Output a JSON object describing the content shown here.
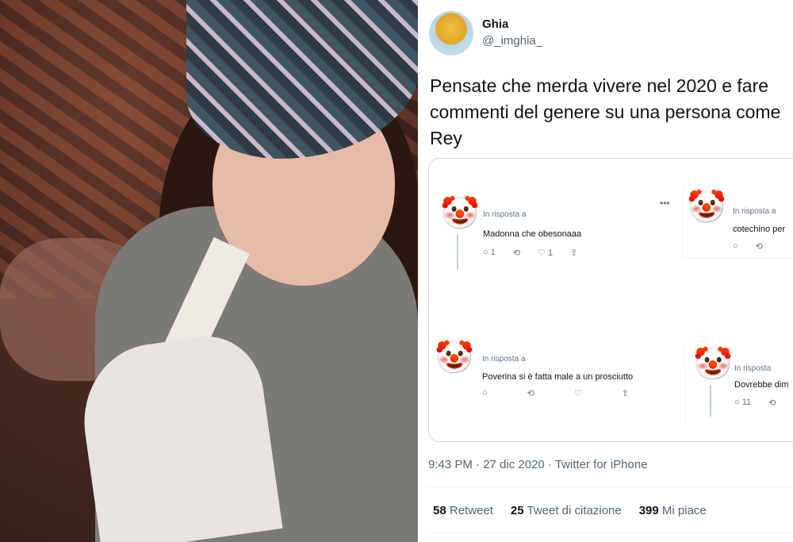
{
  "tweet": {
    "author_name": "Ghia",
    "author_handle": "@_imghia_",
    "text_lines": [
      "Pensate che merda vivere nel 2020 e fare",
      "commenti del genere su una persona come",
      "Rey"
    ],
    "timestamp": "9:43 PM · 27 dic 2020 · Twitter for iPhone",
    "stats": {
      "retweets": {
        "count": "58",
        "label": "Retweet"
      },
      "quotes": {
        "count": "25",
        "label": "Tweet di citazione"
      },
      "likes": {
        "count": "399",
        "label": "Mi piace"
      }
    }
  },
  "embedded_replies": [
    {
      "emoji": "🤡",
      "reply_label": "In risposta a",
      "text": "Madonna che obesonaaa",
      "actions": [
        "1",
        "",
        "1",
        ""
      ]
    },
    {
      "emoji": "🤡",
      "reply_label": "In risposta a",
      "text": "cotechino per",
      "actions": [
        "",
        ""
      ]
    },
    {
      "emoji": "🤡",
      "reply_label": "In risposta a",
      "text": "Poverina si è fatta male a un prosciutto",
      "actions": [
        "",
        "",
        "",
        ""
      ]
    },
    {
      "emoji": "🤡",
      "reply_label": "In risposta",
      "text": "Dovrebbe dim",
      "actions": [
        "11",
        ""
      ]
    }
  ],
  "icons": {
    "comment": "comment-icon",
    "retweet": "retweet-icon",
    "like": "heart-icon",
    "share": "share-icon"
  }
}
